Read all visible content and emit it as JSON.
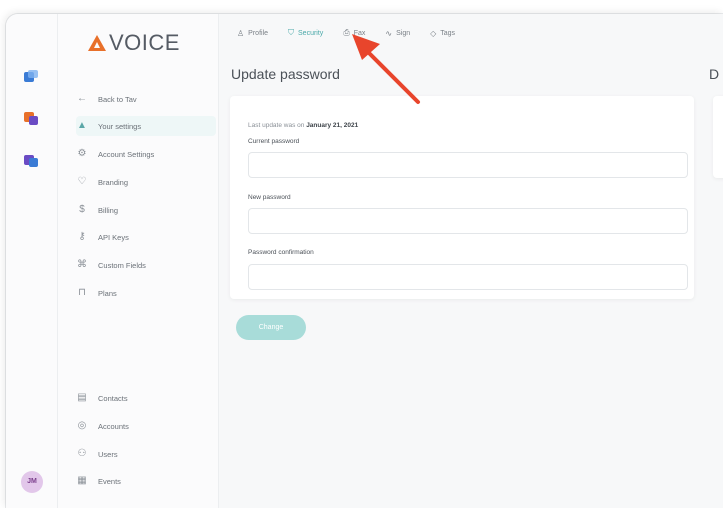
{
  "app": {
    "logo_text": "VOICE"
  },
  "rail": {
    "icons": [
      "app-blue-icon",
      "app-orange-icon",
      "app-purple-icon"
    ],
    "avatar_initials": "JM"
  },
  "sidebar": {
    "items": [
      {
        "label": "Back to Tav",
        "icon": "arrow-left-icon"
      },
      {
        "label": "Your settings",
        "icon": "user-icon",
        "active": true
      },
      {
        "label": "Account Settings",
        "icon": "settings-icon"
      },
      {
        "label": "Branding",
        "icon": "brand-icon"
      },
      {
        "label": "Billing",
        "icon": "dollar-icon"
      },
      {
        "label": "API Keys",
        "icon": "key-icon"
      },
      {
        "label": "Custom Fields",
        "icon": "fields-icon"
      },
      {
        "label": "Plans",
        "icon": "lock-icon"
      }
    ],
    "bottom_items": [
      {
        "label": "Contacts",
        "icon": "contacts-icon"
      },
      {
        "label": "Accounts",
        "icon": "accounts-icon"
      },
      {
        "label": "Users",
        "icon": "users-icon"
      },
      {
        "label": "Events",
        "icon": "events-icon"
      }
    ]
  },
  "tabs": [
    {
      "label": "Profile",
      "icon": "profile-icon"
    },
    {
      "label": "Security",
      "icon": "shield-icon",
      "active": true
    },
    {
      "label": "Fax",
      "icon": "fax-icon"
    },
    {
      "label": "Sign",
      "icon": "sign-icon"
    },
    {
      "label": "Tags",
      "icon": "tag-icon"
    }
  ],
  "main": {
    "title": "Update password",
    "right_title_fragment": "D",
    "last_update_prefix": "Last update was on",
    "last_update_date": "January 21, 2021",
    "fields": [
      {
        "label": "Current password",
        "value": ""
      },
      {
        "label": "New password",
        "value": ""
      },
      {
        "label": "Password confirmation",
        "value": ""
      }
    ],
    "change_button": "Change"
  },
  "colors": {
    "accent": "#4aa9a9",
    "button": "#a8dcd9",
    "annotation_arrow": "#e8452c",
    "logo_orange": "#e8702a"
  }
}
